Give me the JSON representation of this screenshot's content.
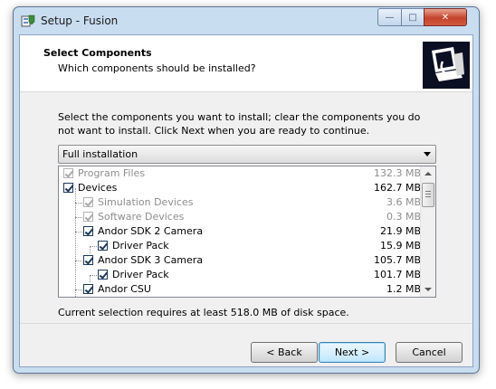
{
  "window": {
    "title": "Setup - Fusion",
    "minimize_label": "—",
    "maximize_label": "□",
    "close_label": "✕"
  },
  "header": {
    "title": "Select Components",
    "subtitle": "Which components should be installed?",
    "image_icon": "computer-install-icon"
  },
  "instructions": "Select the components you want to install; clear the components you do not want to install. Click Next when you are ready to continue.",
  "install_type": {
    "selected": "Full installation"
  },
  "components": [
    {
      "label": "Program Files",
      "size": "132.3 MB",
      "checked": true,
      "disabled": true,
      "level": 0
    },
    {
      "label": "Devices",
      "size": "162.7 MB",
      "checked": true,
      "disabled": false,
      "level": 0
    },
    {
      "label": "Simulation Devices",
      "size": "3.6 MB",
      "checked": true,
      "disabled": true,
      "level": 1
    },
    {
      "label": "Software Devices",
      "size": "0.3 MB",
      "checked": true,
      "disabled": true,
      "level": 1
    },
    {
      "label": "Andor SDK 2 Camera",
      "size": "21.9 MB",
      "checked": true,
      "disabled": false,
      "level": 1
    },
    {
      "label": "Driver Pack",
      "size": "15.9 MB",
      "checked": true,
      "disabled": false,
      "level": 2
    },
    {
      "label": "Andor SDK 3 Camera",
      "size": "105.7 MB",
      "checked": true,
      "disabled": false,
      "level": 1
    },
    {
      "label": "Driver Pack",
      "size": "101.7 MB",
      "checked": true,
      "disabled": false,
      "level": 2
    },
    {
      "label": "Andor CSU",
      "size": "1.2 MB",
      "checked": true,
      "disabled": false,
      "level": 1
    }
  ],
  "disk_space": "Current selection requires at least 518.0 MB of disk space.",
  "buttons": {
    "back": "< Back",
    "next": "Next >",
    "cancel": "Cancel"
  }
}
